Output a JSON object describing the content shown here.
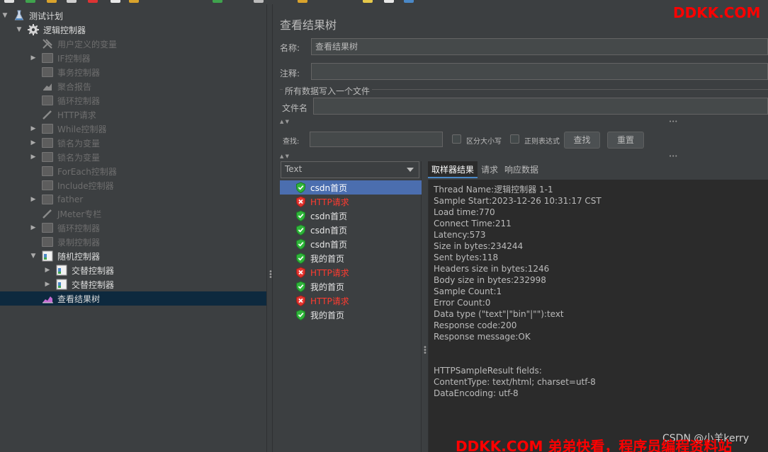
{
  "tree": {
    "items": [
      {
        "label": "测试计划",
        "icon": "flask-icon",
        "depth": 0,
        "expanded": true,
        "disabled": false,
        "selected": false
      },
      {
        "label": "逻辑控制器",
        "icon": "gear-icon",
        "depth": 1,
        "expanded": true,
        "disabled": false,
        "selected": false
      },
      {
        "label": "用户定义的变量",
        "icon": "wrench-icon",
        "depth": 2,
        "expanded": null,
        "disabled": true,
        "selected": false
      },
      {
        "label": "IF控制器",
        "icon": "controller-icon",
        "depth": 2,
        "expanded": false,
        "disabled": true,
        "selected": false
      },
      {
        "label": "事务控制器",
        "icon": "controller-icon",
        "depth": 2,
        "expanded": null,
        "disabled": true,
        "selected": false
      },
      {
        "label": "聚合报告",
        "icon": "chart-icon",
        "depth": 2,
        "expanded": null,
        "disabled": true,
        "selected": false
      },
      {
        "label": "循环控制器",
        "icon": "controller-icon",
        "depth": 2,
        "expanded": null,
        "disabled": true,
        "selected": false
      },
      {
        "label": "HTTP请求",
        "icon": "pipette-icon",
        "depth": 2,
        "expanded": null,
        "disabled": true,
        "selected": false
      },
      {
        "label": "While控制器",
        "icon": "controller-icon",
        "depth": 2,
        "expanded": false,
        "disabled": true,
        "selected": false
      },
      {
        "label": "锁名为变量",
        "icon": "controller-icon",
        "depth": 2,
        "expanded": false,
        "disabled": true,
        "selected": false
      },
      {
        "label": "锁名为变量",
        "icon": "controller-icon",
        "depth": 2,
        "expanded": false,
        "disabled": true,
        "selected": false
      },
      {
        "label": "ForEach控制器",
        "icon": "controller-icon",
        "depth": 2,
        "expanded": null,
        "disabled": true,
        "selected": false
      },
      {
        "label": "Include控制器",
        "icon": "controller-icon",
        "depth": 2,
        "expanded": null,
        "disabled": true,
        "selected": false
      },
      {
        "label": "father",
        "icon": "controller-icon",
        "depth": 2,
        "expanded": false,
        "disabled": true,
        "selected": false
      },
      {
        "label": "JMeter专栏",
        "icon": "pipette-icon",
        "depth": 2,
        "expanded": null,
        "disabled": true,
        "selected": false
      },
      {
        "label": "循环控制器",
        "icon": "controller-icon",
        "depth": 2,
        "expanded": false,
        "disabled": true,
        "selected": false
      },
      {
        "label": "录制控制器",
        "icon": "controller-icon",
        "depth": 2,
        "expanded": null,
        "disabled": true,
        "selected": false
      },
      {
        "label": "随机控制器",
        "icon": "doc-controller-icon",
        "depth": 2,
        "expanded": true,
        "disabled": false,
        "selected": false
      },
      {
        "label": "交替控制器",
        "icon": "doc-controller-icon",
        "depth": 3,
        "expanded": false,
        "disabled": false,
        "selected": false
      },
      {
        "label": "交替控制器",
        "icon": "doc-controller-icon",
        "depth": 3,
        "expanded": false,
        "disabled": false,
        "selected": false
      },
      {
        "label": "查看结果树",
        "icon": "result-tree-icon",
        "depth": 2,
        "expanded": null,
        "disabled": false,
        "selected": true
      }
    ]
  },
  "panel": {
    "title": "查看结果树",
    "name_label": "名称:",
    "name_value": "查看结果树",
    "comment_label": "注释:",
    "comment_value": "",
    "file_group_label": "所有数据写入一个文件",
    "filename_label": "文件名",
    "filename_value": "",
    "search_label": "查找:",
    "search_value": "",
    "case_label": "区分大小写",
    "regex_label": "正则表达式",
    "find_button": "查找",
    "reset_button": "重置"
  },
  "results": {
    "renderer": "Text",
    "samples": [
      {
        "label": "csdn首页",
        "status": "ok",
        "selected": true
      },
      {
        "label": "HTTP请求",
        "status": "error",
        "selected": false
      },
      {
        "label": "csdn首页",
        "status": "ok",
        "selected": false
      },
      {
        "label": "csdn首页",
        "status": "ok",
        "selected": false
      },
      {
        "label": "csdn首页",
        "status": "ok",
        "selected": false
      },
      {
        "label": "我的首页",
        "status": "ok",
        "selected": false
      },
      {
        "label": "HTTP请求",
        "status": "error",
        "selected": false
      },
      {
        "label": "我的首页",
        "status": "ok",
        "selected": false
      },
      {
        "label": "HTTP请求",
        "status": "error",
        "selected": false
      },
      {
        "label": "我的首页",
        "status": "ok",
        "selected": false
      }
    ],
    "tabs": [
      "取样器结果",
      "请求",
      "响应数据"
    ],
    "active_tab": 0,
    "detail_lines": [
      "Thread Name:逻辑控制器 1-1",
      "Sample Start:2023-12-26 10:31:17 CST",
      "Load time:770",
      "Connect Time:211",
      "Latency:573",
      "Size in bytes:234244",
      "Sent bytes:118",
      "Headers size in bytes:1246",
      "Body size in bytes:232998",
      "Sample Count:1",
      "Error Count:0",
      "Data type (\"text\"|\"bin\"|\"\"):text",
      "Response code:200",
      "Response message:OK",
      "",
      "",
      "HTTPSampleResult fields:",
      "ContentType: text/html; charset=utf-8",
      "DataEncoding: utf-8"
    ]
  },
  "watermarks": {
    "top_right": "DDKK.COM",
    "bottom": "DDKK.COM 弟弟快看，程序员编程资料站",
    "csdn": "CSDN @小羊kerry"
  },
  "colors": {
    "background": "#3c3f41",
    "selection": "#4b6eaf",
    "tree_selection": "#0d293e",
    "ok_green": "#2fb53a",
    "error_red": "#ff3b30",
    "watermark_red": "#ff0000"
  }
}
